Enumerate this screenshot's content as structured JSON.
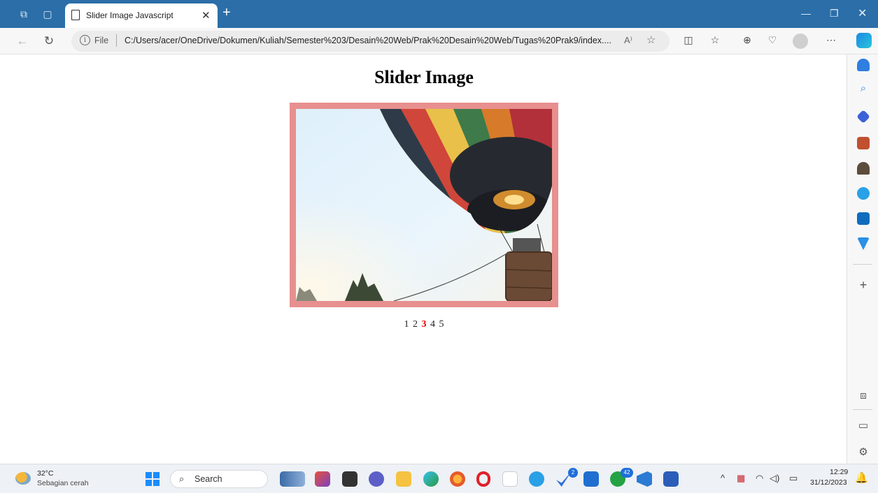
{
  "browser": {
    "tab_title": "Slider Image Javascript",
    "url_scheme_label": "File",
    "url": "C:/Users/acer/OneDrive/Dokumen/Kuliah/Semester%203/Desain%20Web/Prak%20Desain%20Web/Tugas%20Prak9/index....",
    "read_aloud_label": "A⁾"
  },
  "page": {
    "title": "Slider Image",
    "slides": [
      "1",
      "2",
      "3",
      "4",
      "5"
    ],
    "active_slide": "3",
    "frame_color": "#e7908f",
    "active_color": "#e00000"
  },
  "taskbar": {
    "temperature": "32°C",
    "weather": "Sebagian cerah",
    "search_label": "Search",
    "badges": {
      "todo": "2",
      "whatsapp": "42"
    },
    "time": "12:29",
    "date": "31/12/2023"
  },
  "colors": {
    "titlebar": "#2b6ea8",
    "accent": "#1a8cff"
  }
}
